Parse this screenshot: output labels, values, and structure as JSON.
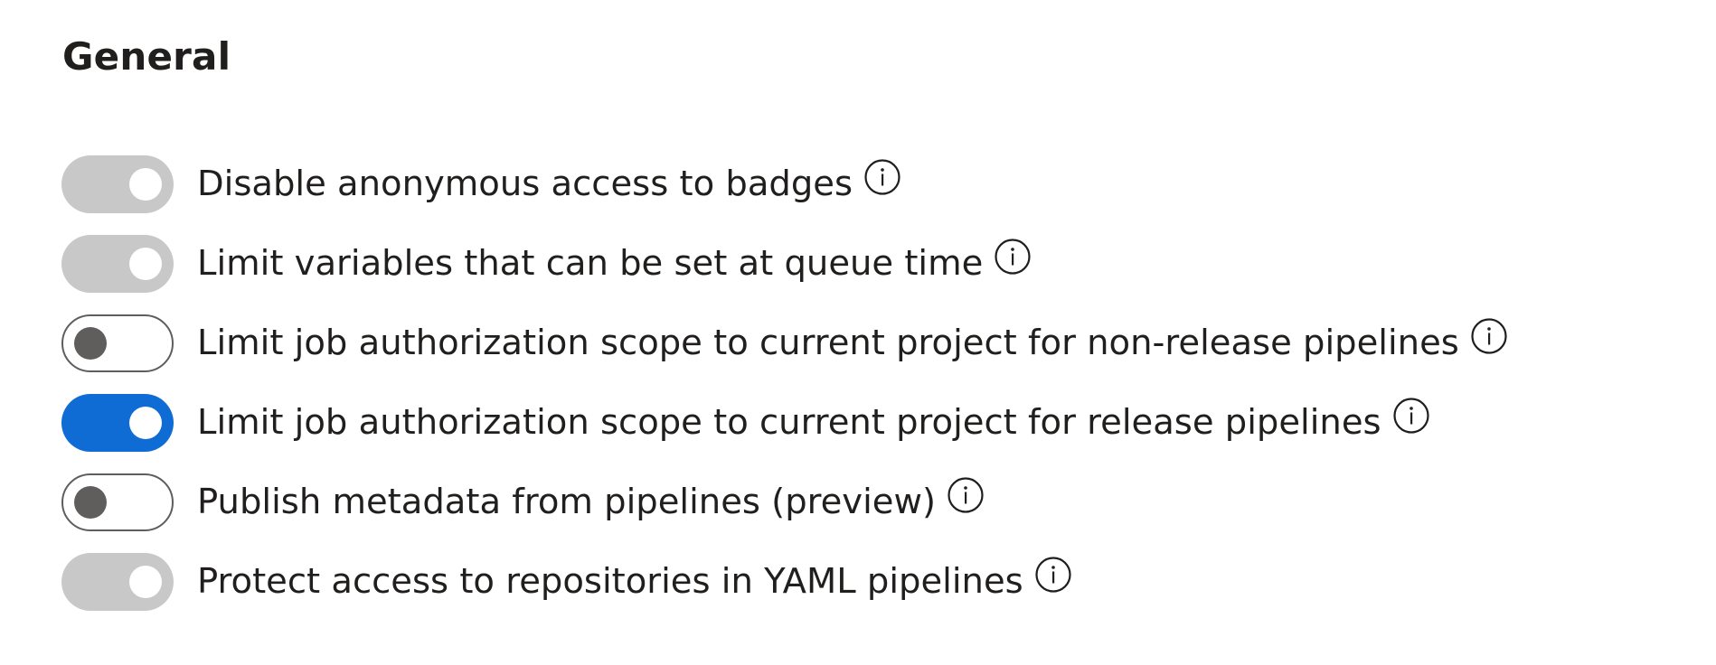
{
  "section": {
    "title": "General"
  },
  "settings": [
    {
      "label": "Disable anonymous access to badges",
      "state": "disabled-on",
      "info_icon": "info-icon"
    },
    {
      "label": "Limit variables that can be set at queue time",
      "state": "disabled-on",
      "info_icon": "info-icon"
    },
    {
      "label": "Limit job authorization scope to current project for non-release pipelines",
      "state": "off",
      "info_icon": "info-icon"
    },
    {
      "label": "Limit job authorization scope to current project for release pipelines",
      "state": "on",
      "info_icon": "info-icon"
    },
    {
      "label": "Publish metadata from pipelines (preview)",
      "state": "off",
      "info_icon": "info-icon"
    },
    {
      "label": "Protect access to repositories in YAML pipelines",
      "state": "disabled-on",
      "info_icon": "info-icon"
    }
  ],
  "colors": {
    "toggle_on": "#0f6cd4",
    "toggle_disabled": "#c8c8c8",
    "toggle_off_border": "#605e5c",
    "text": "#201f1e"
  }
}
